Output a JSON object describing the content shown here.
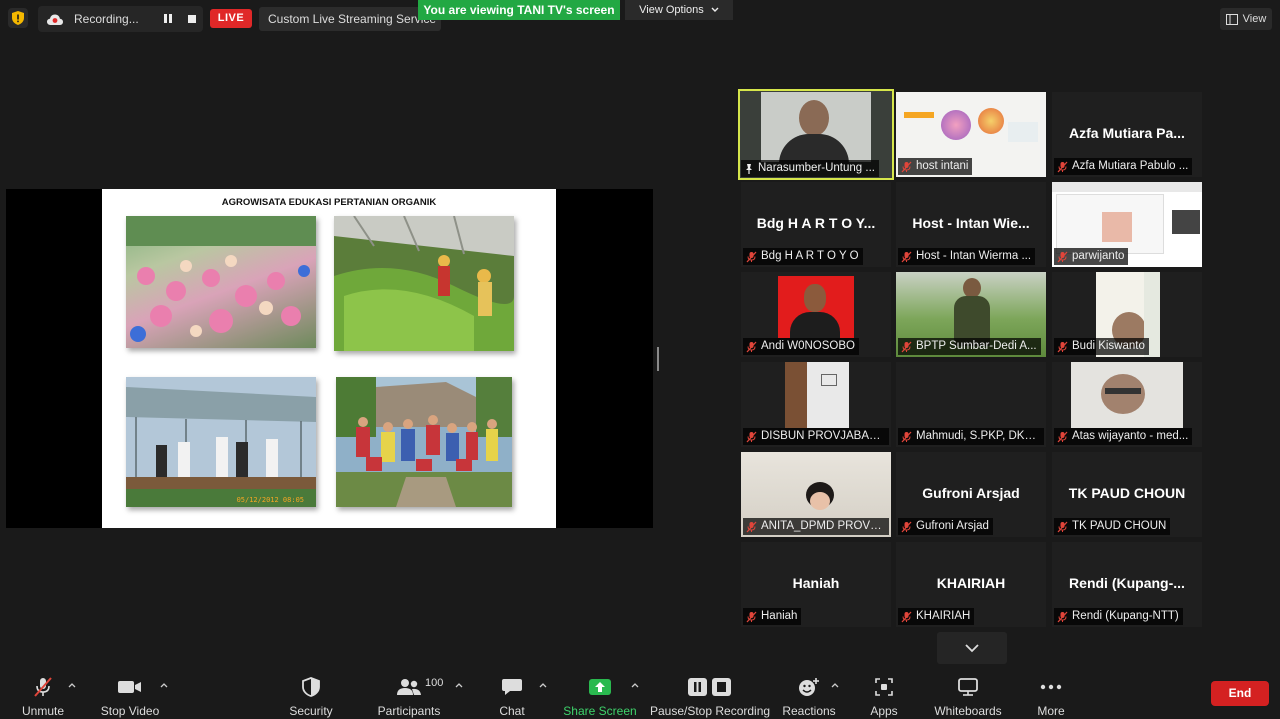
{
  "topbar": {
    "recording_label": "Recording...",
    "live_label": "LIVE",
    "stream_label": "Custom Live Streaming Service",
    "viewing_banner": "You are viewing TANI TV's screen",
    "view_options": "View Options",
    "view_button": "View"
  },
  "slide": {
    "title": "AGROWISATA EDUKASI PERTANIAN ORGANIK",
    "photo_stamp": "05/12/2012 08:05"
  },
  "gallery": {
    "tiles": [
      {
        "label": "Narasumber-Untung ...",
        "big": ""
      },
      {
        "label": "host intani",
        "big": ""
      },
      {
        "label": "Azfa Mutiara Pabulo ...",
        "big": "Azfa Mutiara Pa..."
      },
      {
        "label": "Bdg H A R T O Y O",
        "big": "Bdg H A R T O Y..."
      },
      {
        "label": "Host - Intan Wierma ...",
        "big": "Host - Intan Wie..."
      },
      {
        "label": "parwijanto",
        "big": ""
      },
      {
        "label": "Andi W0NOSOBO",
        "big": ""
      },
      {
        "label": "BPTP Sumbar-Dedi A...",
        "big": ""
      },
      {
        "label": "Budi Kiswanto",
        "big": ""
      },
      {
        "label": "DISBUN PROVJABAR ...",
        "big": ""
      },
      {
        "label": "Mahmudi, S.PKP, DKP...",
        "big": ""
      },
      {
        "label": "Atas wijayanto - med...",
        "big": ""
      },
      {
        "label": "ANITA_DPMD PROVSU",
        "big": ""
      },
      {
        "label": "Gufroni Arsjad",
        "big": "Gufroni Arsjad"
      },
      {
        "label": "TK PAUD CHOUN",
        "big": "TK PAUD CHOUN"
      },
      {
        "label": "Haniah",
        "big": "Haniah"
      },
      {
        "label": "KHAIRIAH",
        "big": "KHAIRIAH"
      },
      {
        "label": "Rendi (Kupang-NTT)",
        "big": "Rendi  (Kupang-..."
      }
    ]
  },
  "toolbar": {
    "unmute": "Unmute",
    "stop_video": "Stop Video",
    "security": "Security",
    "participants": "Participants",
    "participants_count": "100",
    "chat": "Chat",
    "share_screen": "Share Screen",
    "pause_stop_recording": "Pause/Stop Recording",
    "reactions": "Reactions",
    "apps": "Apps",
    "whiteboards": "Whiteboards",
    "more": "More",
    "end": "End"
  },
  "colors": {
    "accent_green": "#22a843",
    "end_red": "#d42121",
    "active_speaker": "#d6e64b",
    "muted_red": "#e0453a"
  }
}
